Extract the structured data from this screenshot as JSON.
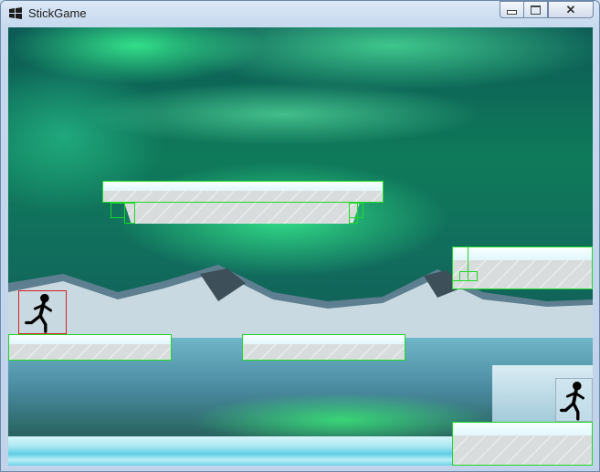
{
  "window": {
    "title": "StickGame",
    "icons": {
      "app": "windows-flag-icon",
      "minimize": "minimize-icon",
      "maximize": "maximize-icon",
      "close": "close-icon"
    },
    "close_glyph": "✕"
  },
  "game": {
    "background": "aurora-over-snowy-mountains",
    "colors": {
      "hitbox": "#1fd82a",
      "player1_box": "#d42020",
      "player2_box": "#9ab0c0",
      "platform_top": "#f2fdff",
      "platform_body": "#d9dcdc"
    },
    "player1": {
      "label": "",
      "state": "running",
      "facing": "right"
    },
    "player2": {
      "label": "",
      "state": "running",
      "facing": "right"
    }
  }
}
